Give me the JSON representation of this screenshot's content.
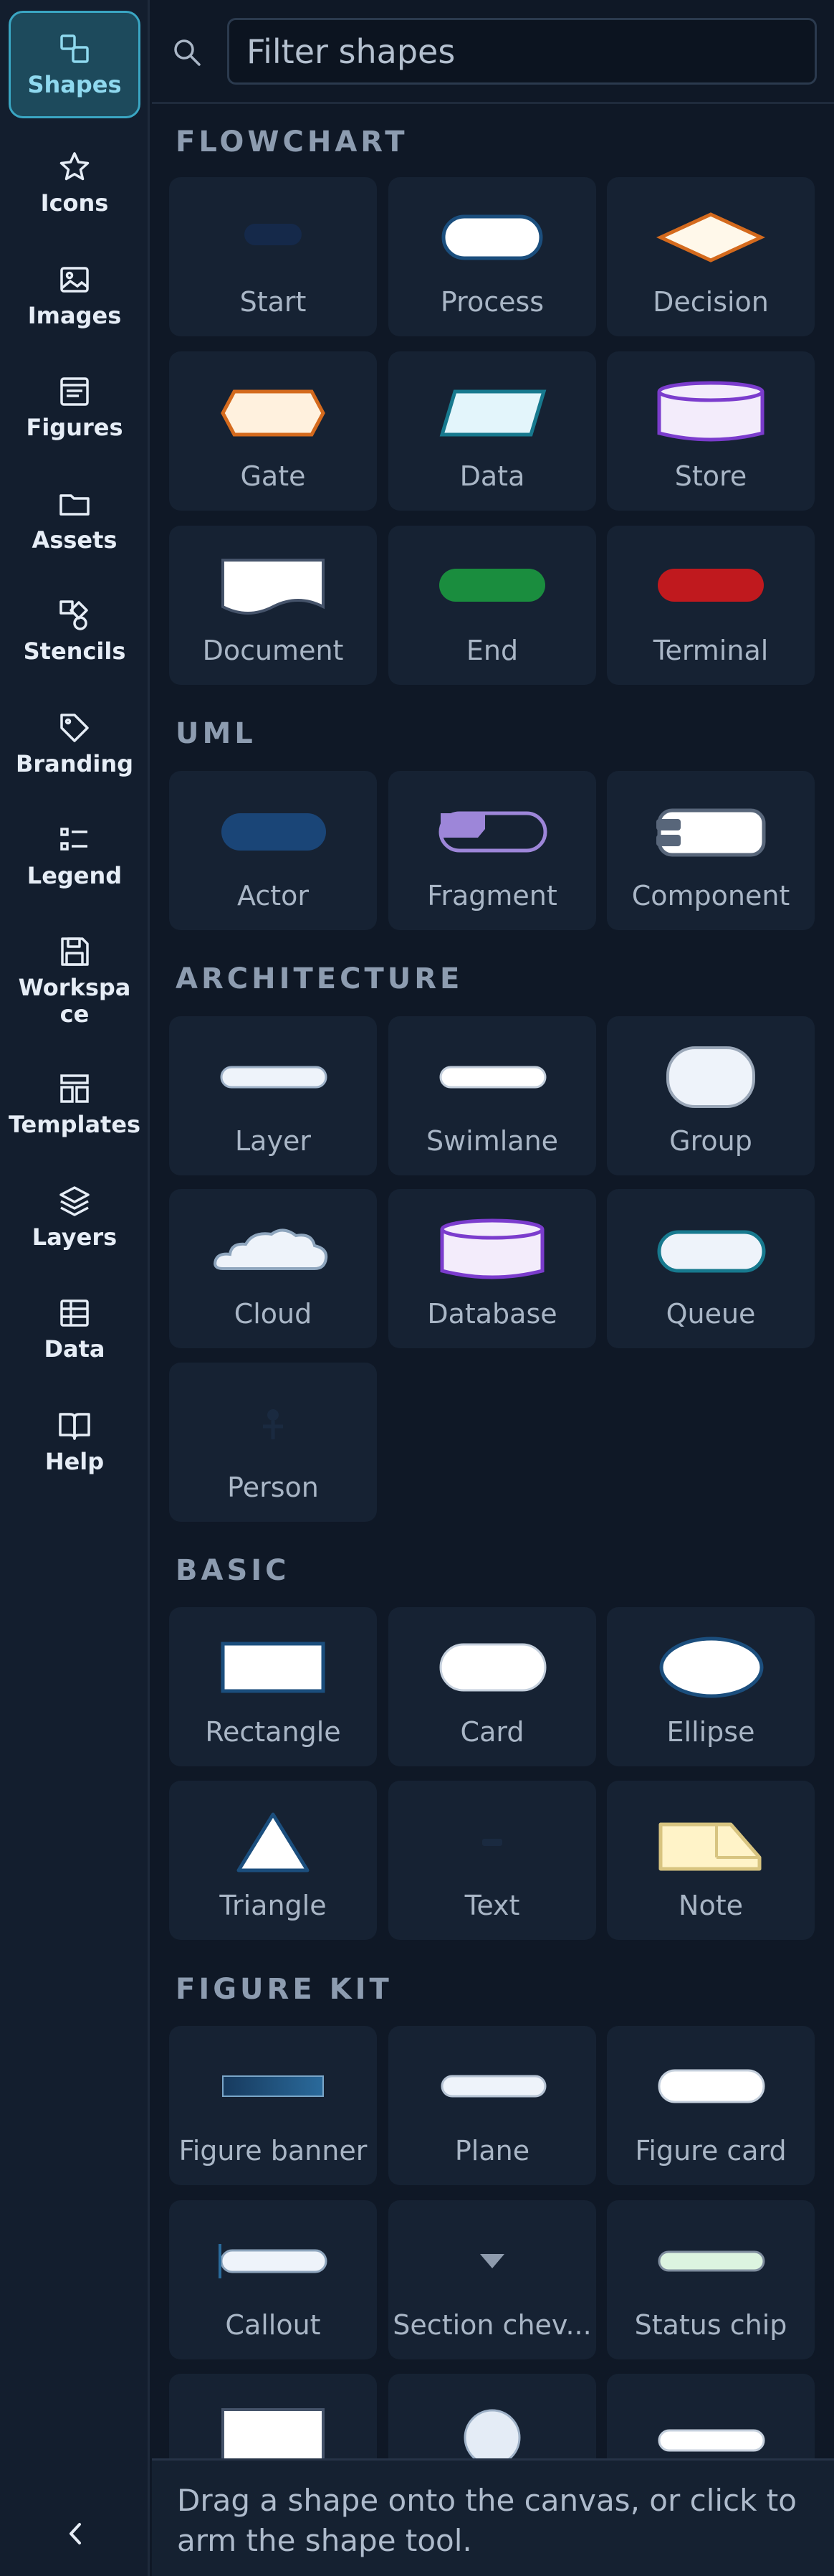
{
  "rail": {
    "items": [
      {
        "label": "Shapes",
        "icon": "shapes-icon",
        "active": true
      },
      {
        "label": "Icons",
        "icon": "star-icon"
      },
      {
        "label": "Images",
        "icon": "image-icon"
      },
      {
        "label": "Figures",
        "icon": "figure-icon"
      },
      {
        "label": "Assets",
        "icon": "folder-icon"
      },
      {
        "label": "Stencils",
        "icon": "stencil-icon"
      },
      {
        "label": "Branding",
        "icon": "tag-icon"
      },
      {
        "label": "Legend",
        "icon": "legend-icon"
      },
      {
        "label": "Workspace",
        "icon": "save-icon"
      },
      {
        "label": "Templates",
        "icon": "templates-icon"
      },
      {
        "label": "Layers",
        "icon": "layers-icon"
      },
      {
        "label": "Data",
        "icon": "table-icon"
      },
      {
        "label": "Help",
        "icon": "book-icon"
      }
    ],
    "collapse_icon": "chevron-left-icon"
  },
  "search": {
    "placeholder": "Filter shapes",
    "value": ""
  },
  "sections": [
    {
      "title": "FLOWCHART",
      "tiles": [
        "Start",
        "Process",
        "Decision",
        "Gate",
        "Data",
        "Store",
        "Document",
        "End",
        "Terminal"
      ]
    },
    {
      "title": "UML",
      "tiles": [
        "Actor",
        "Fragment",
        "Component"
      ]
    },
    {
      "title": "ARCHITECTURE",
      "tiles": [
        "Layer",
        "Swimlane",
        "Group",
        "Cloud",
        "Database",
        "Queue",
        "Person"
      ]
    },
    {
      "title": "BASIC",
      "tiles": [
        "Rectangle",
        "Card",
        "Ellipse",
        "Triangle",
        "Text",
        "Note"
      ]
    },
    {
      "title": "FIGURE KIT",
      "tiles": [
        "Figure banner",
        "Plane",
        "Figure card",
        "Callout",
        "Section chev...",
        "Status chip",
        "",
        "",
        ""
      ]
    }
  ],
  "footer": {
    "hint": "Drag a shape onto the canvas, or click to arm the shape tool."
  },
  "colors": {
    "accent": "#3aa6c3",
    "background": "#0f1826",
    "tile": "#162233"
  }
}
